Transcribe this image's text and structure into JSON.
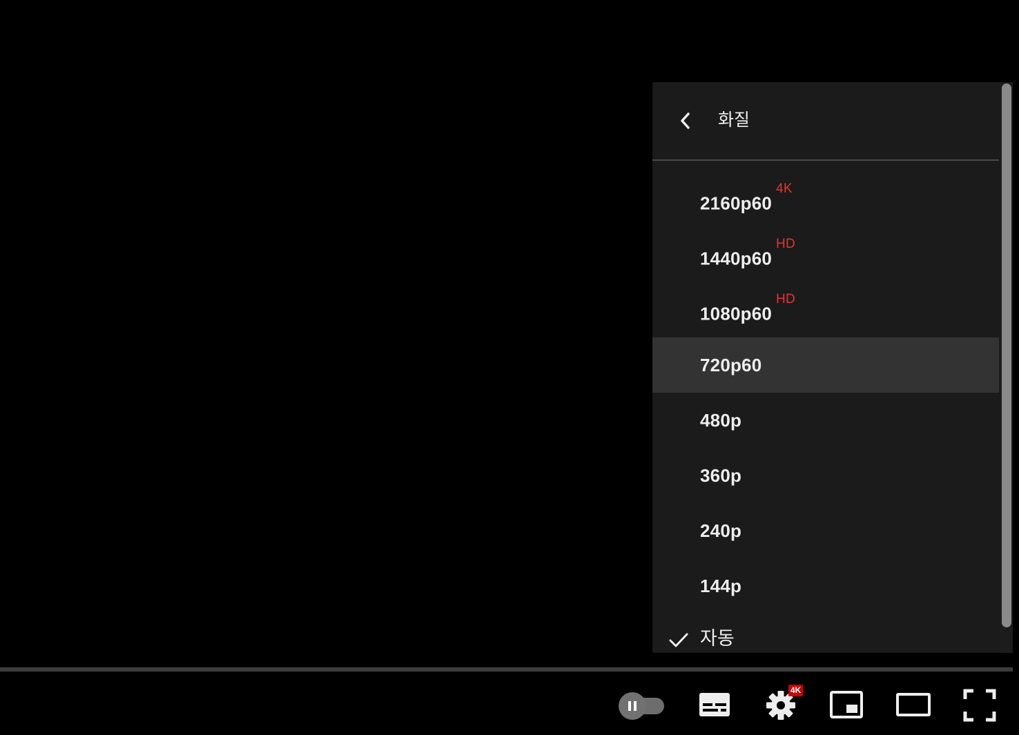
{
  "menu": {
    "title": "화질",
    "back_icon": "chevron-left-icon",
    "items": [
      {
        "label": "2160p60",
        "badge": "4K"
      },
      {
        "label": "1440p60",
        "badge": "HD"
      },
      {
        "label": "1080p60",
        "badge": "HD"
      },
      {
        "label": "720p60",
        "badge": ""
      },
      {
        "label": "480p",
        "badge": ""
      },
      {
        "label": "360p",
        "badge": ""
      },
      {
        "label": "240p",
        "badge": ""
      },
      {
        "label": "144p",
        "badge": ""
      },
      {
        "label": "자동",
        "badge": "",
        "selected": true
      }
    ]
  },
  "controls": {
    "settings_badge": "4K",
    "icons": [
      "autoplay-toggle-icon",
      "subtitles-icon",
      "settings-gear-icon",
      "miniplayer-icon",
      "theater-mode-icon",
      "fullscreen-icon"
    ]
  },
  "colors": {
    "menu_bg": "#1c1c1c",
    "hover_bg": "#333333",
    "badge_red": "#e1382e",
    "text": "#eeeeee"
  }
}
